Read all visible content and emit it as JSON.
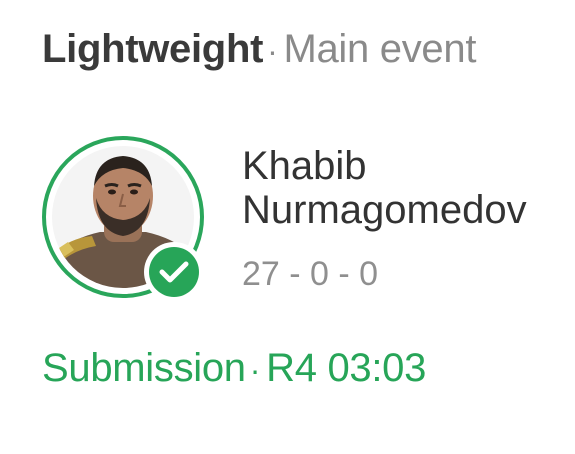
{
  "header": {
    "weight_class": "Lightweight",
    "separator": "·",
    "event_type": "Main event"
  },
  "fighter": {
    "first_name": "Khabib",
    "last_name": "Nurmagomedov",
    "record": "27 - 0 - 0",
    "winner": true,
    "avatar_icon": "fighter-photo",
    "badge_icon": "checkmark-icon"
  },
  "result": {
    "method": "Submission",
    "separator": "·",
    "round_time": "R4 03:03"
  },
  "colors": {
    "accent_green": "#27a558",
    "title_text": "#3a3a3a",
    "muted_text": "#8a8a8a"
  }
}
